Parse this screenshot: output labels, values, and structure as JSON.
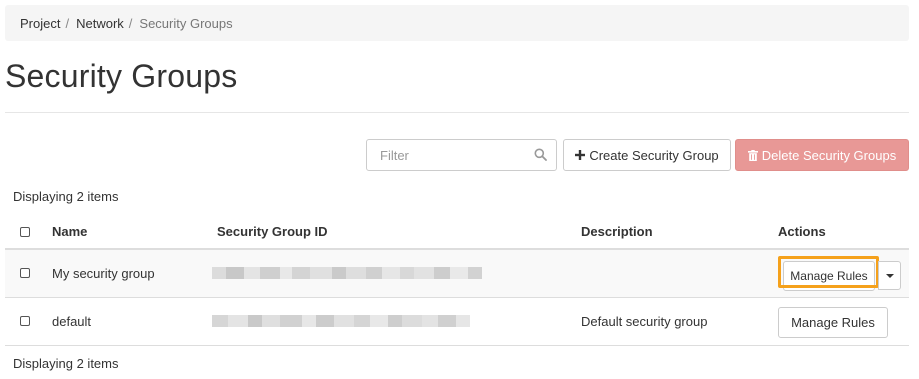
{
  "breadcrumb": {
    "items": [
      "Project",
      "Network",
      "Security Groups"
    ],
    "separator": "/"
  },
  "page": {
    "title": "Security Groups"
  },
  "toolbar": {
    "filter_placeholder": "Filter",
    "filter_icon": "search-icon",
    "create_label": "Create Security Group",
    "create_icon": "plus-icon",
    "delete_label": "Delete Security Groups",
    "delete_icon": "trash-icon",
    "delete_color": "#e89896"
  },
  "table": {
    "count_label": "Displaying 2 items",
    "columns": [
      "Name",
      "Security Group ID",
      "Description",
      "Actions"
    ],
    "rows": [
      {
        "name": "My security group",
        "id_redacted": true,
        "description": "",
        "action_label": "Manage Rules",
        "has_dropdown": true,
        "highlighted": true
      },
      {
        "name": "default",
        "id_redacted": true,
        "description": "Default security group",
        "action_label": "Manage Rules",
        "has_dropdown": false,
        "highlighted": false
      }
    ]
  },
  "highlight_color": "#f5a11b"
}
